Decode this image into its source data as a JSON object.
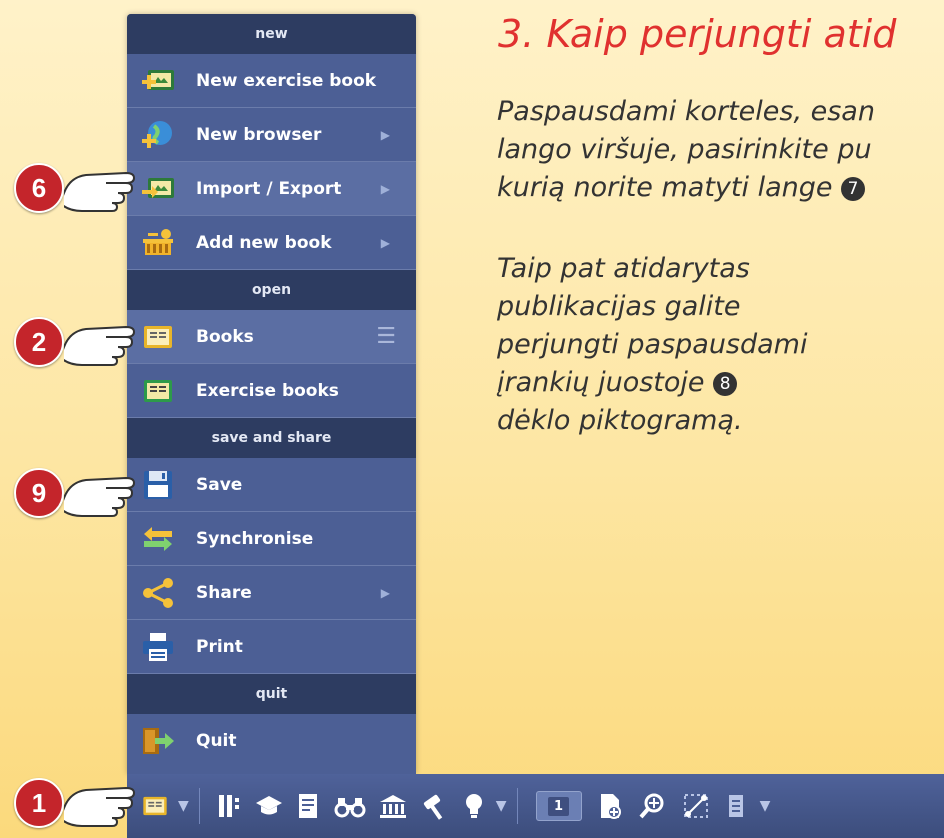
{
  "menu": {
    "sections": {
      "new": "new",
      "open": "open",
      "save_share": "save and share",
      "quit": "quit"
    },
    "items": {
      "new_exercise_book": "New exercise book",
      "new_browser": "New browser",
      "import_export": "Import / Export",
      "add_new_book": "Add new book",
      "books": "Books",
      "exercise_books": "Exercise books",
      "save": "Save",
      "synchronise": "Synchronise",
      "share": "Share",
      "print": "Print",
      "quit": "Quit"
    }
  },
  "toolbar": {
    "page_number": "1"
  },
  "content": {
    "title": "3. Kaip perjungti atid",
    "p1_line1": "Paspausdami korteles, esan",
    "p1_line2": "lango viršuje, pasirinkite pu",
    "p1_line3": "kurią norite matyti lange",
    "p1_num": "7",
    "p2_line1": "Taip pat atidarytas",
    "p2_line2": "publikacijas galite",
    "p2_line3": "perjungti paspausdami",
    "p2_line4": "įrankių juostoje",
    "p2_num": "8",
    "p2_line5": "dėklo piktogramą."
  },
  "callouts": {
    "c6": "6",
    "c2": "2",
    "c9": "9",
    "c1": "1"
  },
  "colors": {
    "accent_red": "#c4252b",
    "title_red": "#e0312f",
    "menu_bg": "#4c5f95",
    "section_bg": "#2d3c61"
  }
}
